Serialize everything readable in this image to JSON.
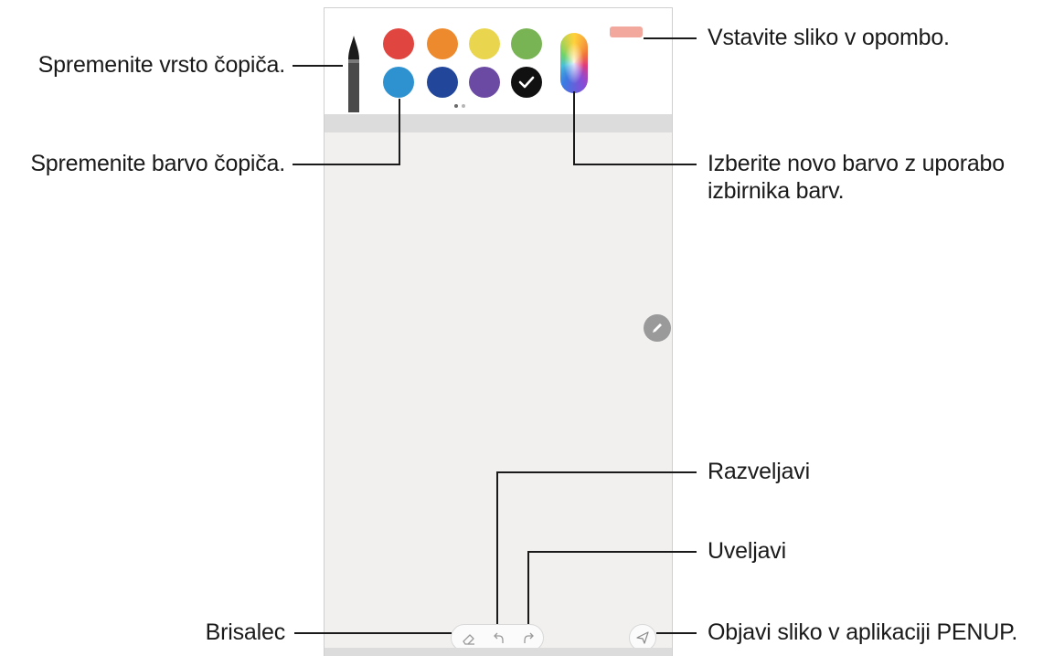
{
  "annotations": {
    "brush_type": "Spremenite vrsto čopiča.",
    "brush_color": "Spremenite barvo čopiča.",
    "insert_image": "Vstavite sliko v opombo.",
    "color_picker": "Izberite novo barvo z uporabo izbirnika barv.",
    "undo": "Razveljavi",
    "redo": "Uveljavi",
    "eraser": "Brisalec",
    "publish": "Objavi sliko v aplikaciji PENUP."
  },
  "palette": {
    "row1": [
      "#e0463f",
      "#ee8a2e",
      "#ead64e",
      "#78b354"
    ],
    "row2": [
      "#2f92d0",
      "#21469a",
      "#6b4aa4",
      "#111111"
    ],
    "selected_index_row2": 3
  },
  "colors": {
    "canvas": "#f1f0ef",
    "insert_button": "#f2a89c",
    "fab": "#9a9a9a"
  },
  "icons": {
    "brush": "pencil-brush-icon",
    "check": "check-icon",
    "pen_fab": "pen-icon",
    "eraser": "eraser-icon",
    "undo": "undo-icon",
    "redo": "redo-icon",
    "send": "send-icon"
  }
}
